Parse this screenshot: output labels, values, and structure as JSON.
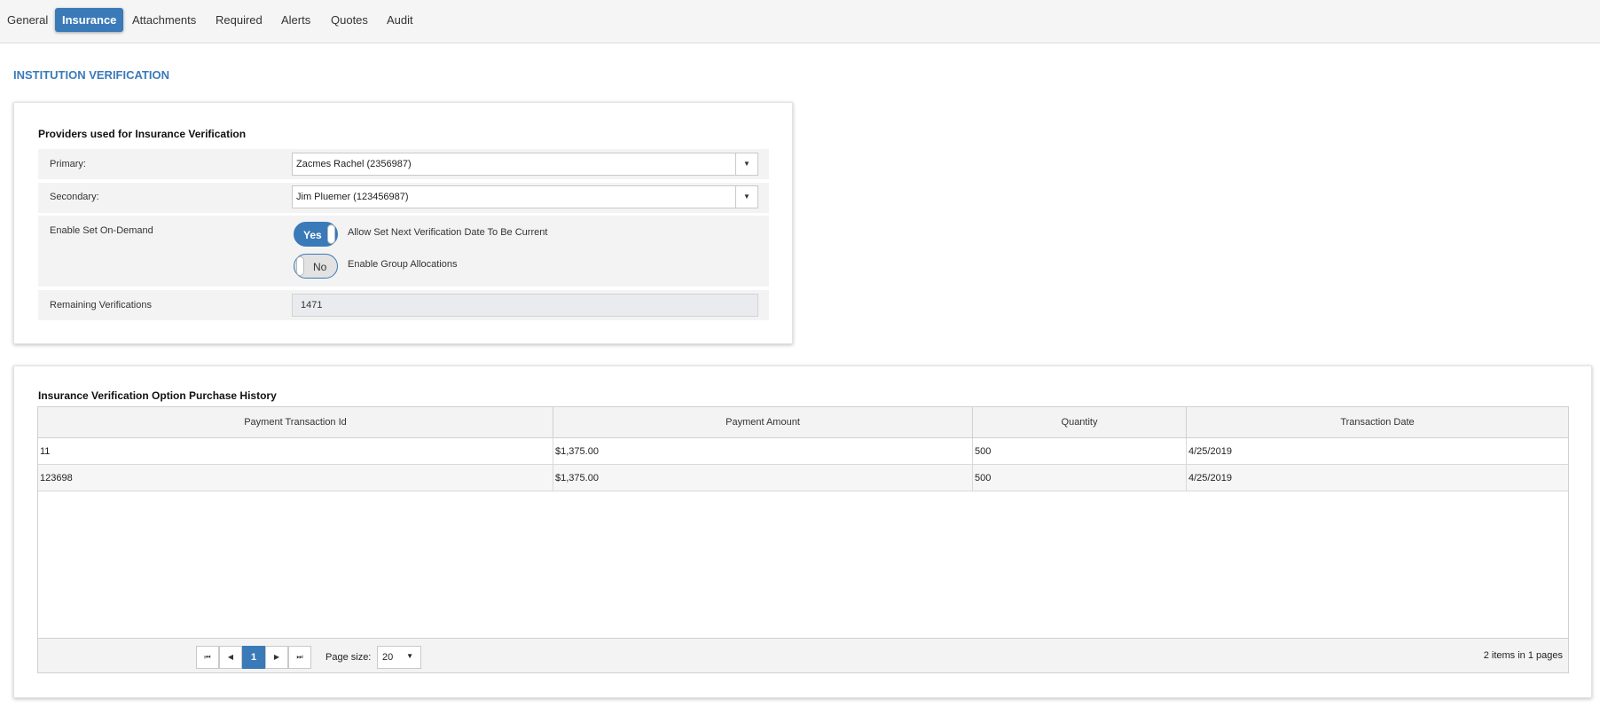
{
  "tabs": [
    {
      "label": "General"
    },
    {
      "label": "Insurance"
    },
    {
      "label": "Attachments"
    },
    {
      "label": "Required"
    },
    {
      "label": "Alerts"
    },
    {
      "label": "Quotes"
    },
    {
      "label": "Audit"
    }
  ],
  "active_tab": "Insurance",
  "section_title": "INSTITUTION VERIFICATION",
  "providers": {
    "title": "Providers used for Insurance Verification",
    "primary_label": "Primary:",
    "primary_value": "Zacmes Rachel (2356987)",
    "secondary_label": "Secondary:",
    "secondary_value": "Jim Pluemer (123456987)",
    "enable_label": "Enable Set On-Demand",
    "toggle1_state": "Yes",
    "toggle1_desc": "Allow Set Next Verification Date To Be Current",
    "toggle2_state": "No",
    "toggle2_desc": "Enable Group Allocations",
    "remaining_label": "Remaining Verifications",
    "remaining_value": "1471"
  },
  "history": {
    "title": "Insurance Verification Option Purchase History",
    "columns": [
      "Payment Transaction Id",
      "Payment Amount",
      "Quantity",
      "Transaction Date"
    ],
    "rows": [
      [
        "11",
        "$1,375.00",
        "500",
        "4/25/2019"
      ],
      [
        "123698",
        "$1,375.00",
        "500",
        "4/25/2019"
      ]
    ],
    "pager": {
      "current_page": "1",
      "page_size_label": "Page size:",
      "page_size": "20",
      "summary": "2 items in 1 pages"
    }
  },
  "colors": {
    "accent": "#3a7ab8",
    "toolbar_bg": "#f5f5f5"
  }
}
